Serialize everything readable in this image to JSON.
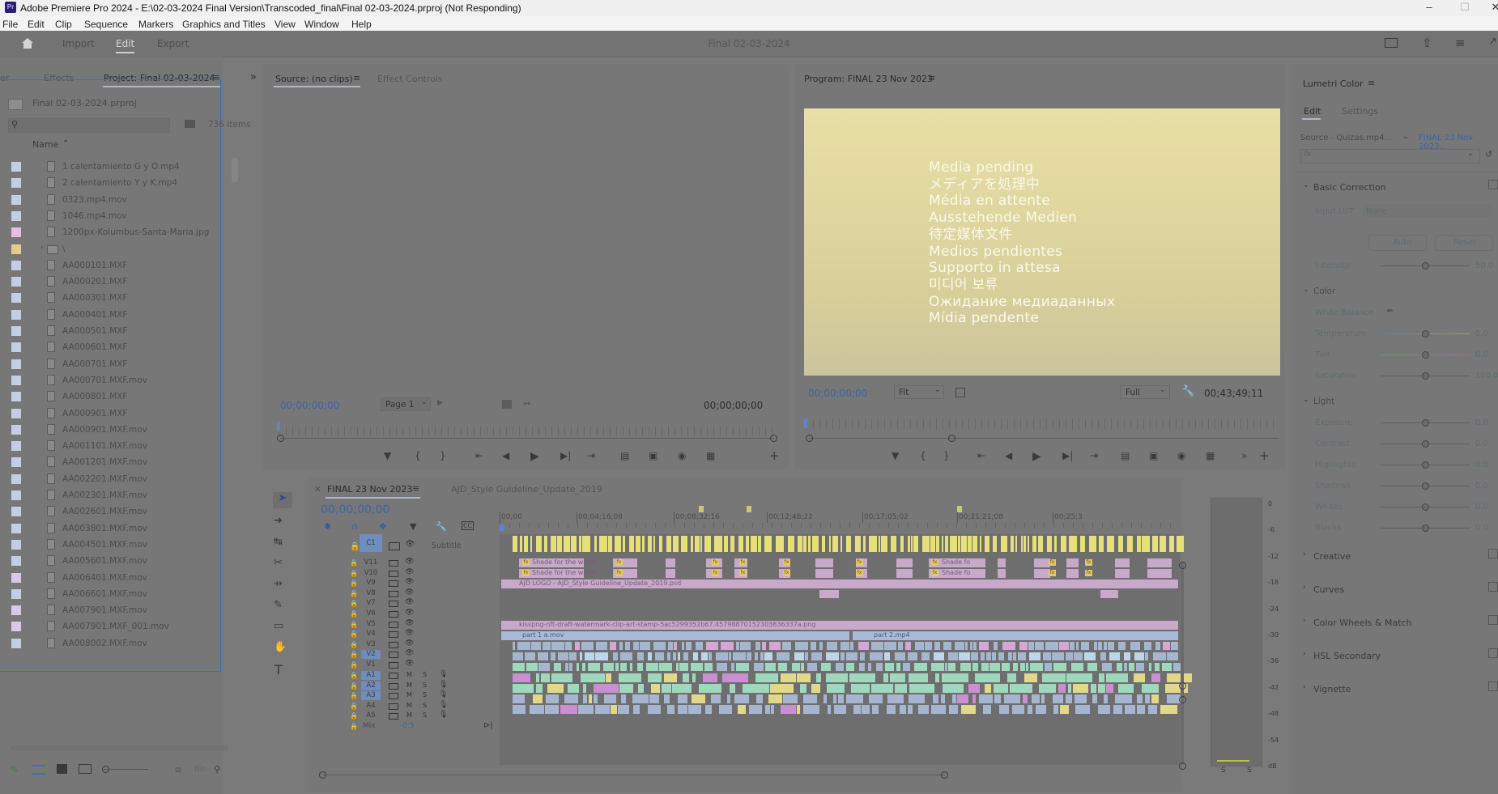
{
  "titlebar": {
    "app_icon": "Pr",
    "title": "Adobe Premiere Pro 2024 - E:\\02-03-2024 Final Version\\Transcoded_final\\Final 02-03-2024.prproj (Not Responding)"
  },
  "menu": [
    "File",
    "Edit",
    "Clip",
    "Sequence",
    "Markers",
    "Graphics and Titles",
    "View",
    "Window",
    "Help"
  ],
  "header": {
    "workspaces": [
      "Import",
      "Edit",
      "Export"
    ],
    "active_workspace": "Edit",
    "project_title": "Final 02-03-2024"
  },
  "project_panel": {
    "tabs": [
      "er",
      "Effects",
      "Project: Final 02-03-2024"
    ],
    "project_file": "Final 02-03-2024.prproj",
    "item_count": "736 items",
    "column_header": "Name",
    "items": [
      {
        "name": "1 calentamiento G y O.mp4",
        "color": "#c4cce8",
        "type": "file"
      },
      {
        "name": "2 calentamiento Y y K.mp4",
        "color": "#c4cce8",
        "type": "file"
      },
      {
        "name": "0323.mp4.mov",
        "color": "#c4cce8",
        "type": "file"
      },
      {
        "name": "1046.mp4.mov",
        "color": "#c4cce8",
        "type": "file"
      },
      {
        "name": "1200px-Kolumbus-Santa-Maria.jpg",
        "color": "#e8bde0",
        "type": "file"
      },
      {
        "name": "\\",
        "color": "#e6c98f",
        "type": "folder"
      },
      {
        "name": "AA000101.MXF",
        "color": "#c4cce8",
        "type": "file"
      },
      {
        "name": "AA000201.MXF",
        "color": "#c4cce8",
        "type": "file"
      },
      {
        "name": "AA000301.MXF",
        "color": "#c4cce8",
        "type": "file"
      },
      {
        "name": "AA000401.MXF",
        "color": "#c4cce8",
        "type": "file"
      },
      {
        "name": "AA000501.MXF",
        "color": "#c4cce8",
        "type": "file"
      },
      {
        "name": "AA000601.MXF",
        "color": "#c4cce8",
        "type": "file"
      },
      {
        "name": "AA000701.MXF",
        "color": "#c4cce8",
        "type": "file"
      },
      {
        "name": "AA000701.MXF.mov",
        "color": "#c4cce8",
        "type": "file"
      },
      {
        "name": "AA000801.MXF",
        "color": "#c4cce8",
        "type": "file"
      },
      {
        "name": "AA000901.MXF",
        "color": "#c4cce8",
        "type": "file"
      },
      {
        "name": "AA000901.MXF.mov",
        "color": "#c4cce8",
        "type": "file"
      },
      {
        "name": "AA001101.MXF.mov",
        "color": "#c4cce8",
        "type": "file"
      },
      {
        "name": "AA001201.MXF.mov",
        "color": "#c4cce8",
        "type": "file"
      },
      {
        "name": "AA002201.MXF.mov",
        "color": "#c4cce8",
        "type": "file"
      },
      {
        "name": "AA002301.MXF.mov",
        "color": "#c4cce8",
        "type": "file"
      },
      {
        "name": "AA002601.MXF.mov",
        "color": "#c4cce8",
        "type": "file"
      },
      {
        "name": "AA003801.MXF.mov",
        "color": "#c4cce8",
        "type": "file"
      },
      {
        "name": "AA004501.MXF.mov",
        "color": "#c4cce8",
        "type": "file"
      },
      {
        "name": "AA005601.MXF.mov",
        "color": "#c4cce8",
        "type": "file"
      },
      {
        "name": "AA006401.MXF.mov",
        "color": "#d8c8ec",
        "type": "file"
      },
      {
        "name": "AA006601.MXF.mov",
        "color": "#c4cce8",
        "type": "file"
      },
      {
        "name": "AA007901.MXF.mov",
        "color": "#d8c8ec",
        "type": "file"
      },
      {
        "name": "AA007901.MXF_001.mov",
        "color": "#d8c8ec",
        "type": "file"
      },
      {
        "name": "AA008002.MXF.mov",
        "color": "#c4cce8",
        "type": "file"
      }
    ],
    "footer_label": "Bin"
  },
  "source_monitor": {
    "tabs": [
      "Source: (no clips)",
      "Effect Controls"
    ],
    "timecode_in": "00;00;00;00",
    "timecode_out": "00;00;00;00",
    "page_select": "Page 1"
  },
  "program_monitor": {
    "tab": "Program: FINAL 23 Nov 2023",
    "pending_messages": [
      "Media pending",
      "メディアを処理中",
      "Média en attente",
      "Ausstehende Medien",
      "待定媒体文件",
      "Medios pendientes",
      "Supporto in attesa",
      "미디어 보류",
      "Ожидание медиаданных",
      "Mídia pendente"
    ],
    "timecode": "00;00;00;00",
    "fit": "Fit",
    "resolution": "Full",
    "duration": "00;43;49;11"
  },
  "timeline": {
    "tabs": [
      "FINAL 23 Nov 2023",
      "AJD_Style Guideline_Update_2019"
    ],
    "timecode": "00;00;00;00",
    "ruler": [
      "00;00",
      "00;04;16;08",
      "00;08;32;16",
      "00;12;48;22",
      "00;17;05;02",
      "00;21;21;08",
      "00;25;3"
    ],
    "caption_track": {
      "label": "C1",
      "name": "Subtitle"
    },
    "video_tracks": [
      "V11",
      "V10",
      "V9",
      "V8",
      "V7",
      "V6",
      "V5",
      "V4",
      "V3",
      "V2",
      "V1"
    ],
    "audio_tracks": [
      "A1",
      "A2",
      "A3",
      "A4",
      "A5"
    ],
    "mix_label": "Mix",
    "mix_value": "-0.5",
    "clip_labels": {
      "shade1": "Shade for the white",
      "shade2": "Shade for the white",
      "shade3": "Shade fo",
      "shade4": "Shade fo",
      "logo": "AJD LOGO - AJD_Style Guideline_Update_2019.psd",
      "watermark": "kisspng-nft-draft-watermark-clip-art-stamp-5ac5299352b67.45798870152303836337a.png",
      "part1": "part 1 a.mov",
      "part2": "part 2.mp4",
      "fx": "fx"
    },
    "audio_meter_scale": [
      "0",
      "-6",
      "-12",
      "-18",
      "-24",
      "-30",
      "-36",
      "-42",
      "-48",
      "-54",
      "dB"
    ],
    "meter_solo": [
      "S",
      "S"
    ]
  },
  "lumetri": {
    "title": "Lumetri Color",
    "tabs": [
      "Edit",
      "Settings"
    ],
    "source": "Source - Quizas.mp4...",
    "sequence": "FINAL 23 Nov 2023...",
    "fx_label": "fx",
    "sections": {
      "basic": "Basic Correction",
      "input_lut_label": "Input LUT",
      "input_lut_value": "None",
      "auto": "Auto",
      "reset": "Reset",
      "intensity": "Intensity",
      "intensity_value": "50.0",
      "color": "Color",
      "white_balance": "White Balance",
      "temperature": "Temperature",
      "temperature_value": "0.0",
      "tint": "Tint",
      "tint_value": "0.0",
      "saturation": "Saturation",
      "saturation_value": "100.0",
      "light": "Light",
      "exposure": "Exposure",
      "exposure_value": "0.0",
      "contrast": "Contrast",
      "contrast_value": "0.0",
      "highlights": "Highlights",
      "highlights_value": "0.0",
      "shadows": "Shadows",
      "shadows_value": "0.0",
      "whites": "Whites",
      "whites_value": "0.0",
      "blacks": "Blacks",
      "blacks_value": "0.0",
      "creative": "Creative",
      "curves": "Curves",
      "color_wheels": "Color Wheels & Match",
      "hsl": "HSL Secondary",
      "vignette": "Vignette"
    }
  }
}
